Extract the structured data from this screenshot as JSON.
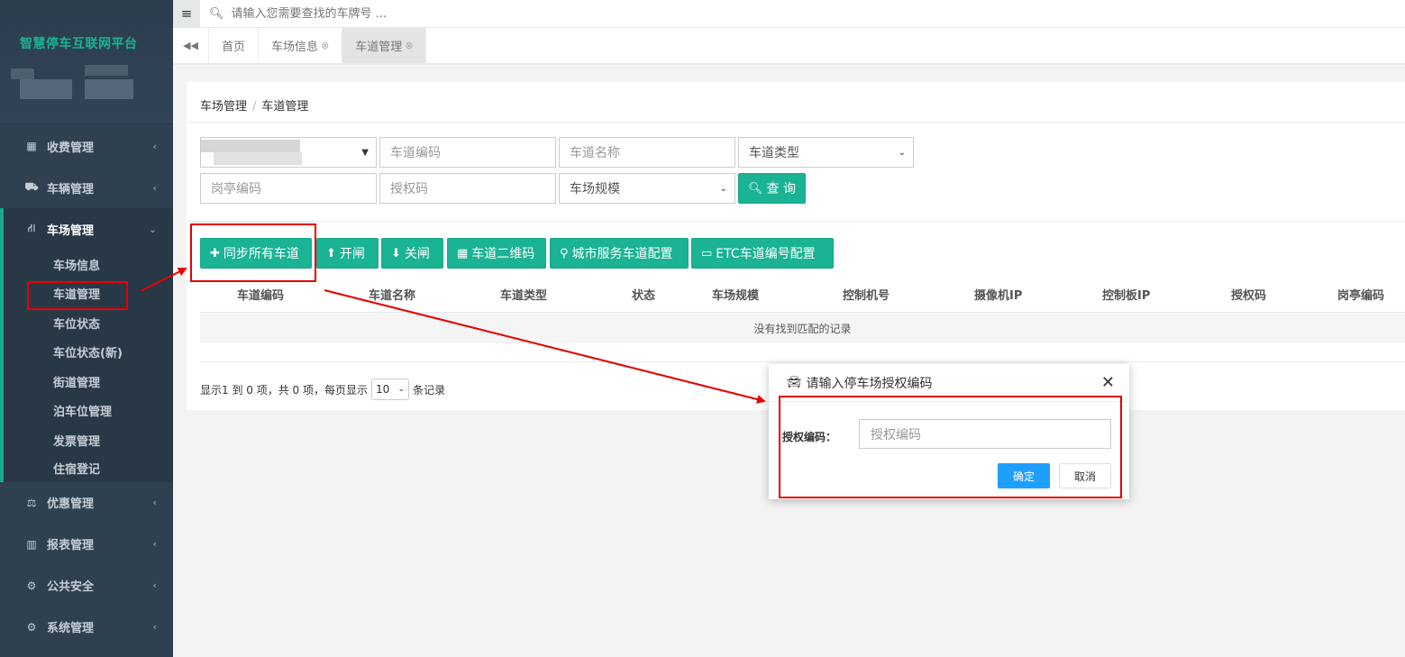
{
  "sidebar": {
    "brand": "智慧停车互联网平台",
    "items": [
      {
        "label": "收费管理",
        "icon": "grid-icon"
      },
      {
        "label": "车辆管理",
        "icon": "car-icon"
      },
      {
        "label": "车场管理",
        "icon": "road-icon",
        "expanded": true
      },
      {
        "label": "优惠管理",
        "icon": "balance-scale-icon"
      },
      {
        "label": "报表管理",
        "icon": "bar-chart-icon"
      },
      {
        "label": "公共安全",
        "icon": "cogs-icon"
      },
      {
        "label": "系统管理",
        "icon": "cogs-icon"
      }
    ],
    "subitems": [
      "车场信息",
      "车道管理",
      "车位状态",
      "车位状态(新)",
      "街道管理",
      "泊车位管理",
      "发票管理",
      "住宿登记"
    ]
  },
  "topbar": {
    "search_placeholder": "请输入您需要查找的车牌号 ..."
  },
  "tabs": [
    {
      "label": "首页"
    },
    {
      "label": "车场信息"
    },
    {
      "label": "车道管理",
      "active": true
    }
  ],
  "breadcrumb": [
    "车场管理",
    "车道管理"
  ],
  "filters": {
    "lane_code": "车道编码",
    "lane_name": "车道名称",
    "lane_type": "车道类型",
    "booth_code": "岗亭编码",
    "auth_code": "授权码",
    "lot_scale": "车场规模",
    "query": "查 询"
  },
  "toolbar": {
    "sync": "同步所有车道",
    "open": "开闸",
    "close": "关闸",
    "qrcode": "车道二维码",
    "city": "城市服务车道配置",
    "etc": "ETC车道编号配置"
  },
  "table": {
    "headers": [
      "车道编码",
      "车道名称",
      "车道类型",
      "状态",
      "车场规模",
      "控制机号",
      "摄像机IP",
      "控制板IP",
      "授权码",
      "岗亭编码"
    ],
    "empty": "没有找到匹配的记录"
  },
  "pager": {
    "prefix": "显示1 到 0 项，共 0 项，每页显示",
    "page_size": "10",
    "suffix": "条记录"
  },
  "modal": {
    "title": "请输入停车场授权编码",
    "label": "授权编码：",
    "placeholder": "授权编码",
    "ok": "确定",
    "cancel": "取消"
  },
  "colors": {
    "sidebar": "#2f4050",
    "accent": "#1ab394",
    "ok_button": "#1e9fff",
    "annotation": "#e60000"
  }
}
